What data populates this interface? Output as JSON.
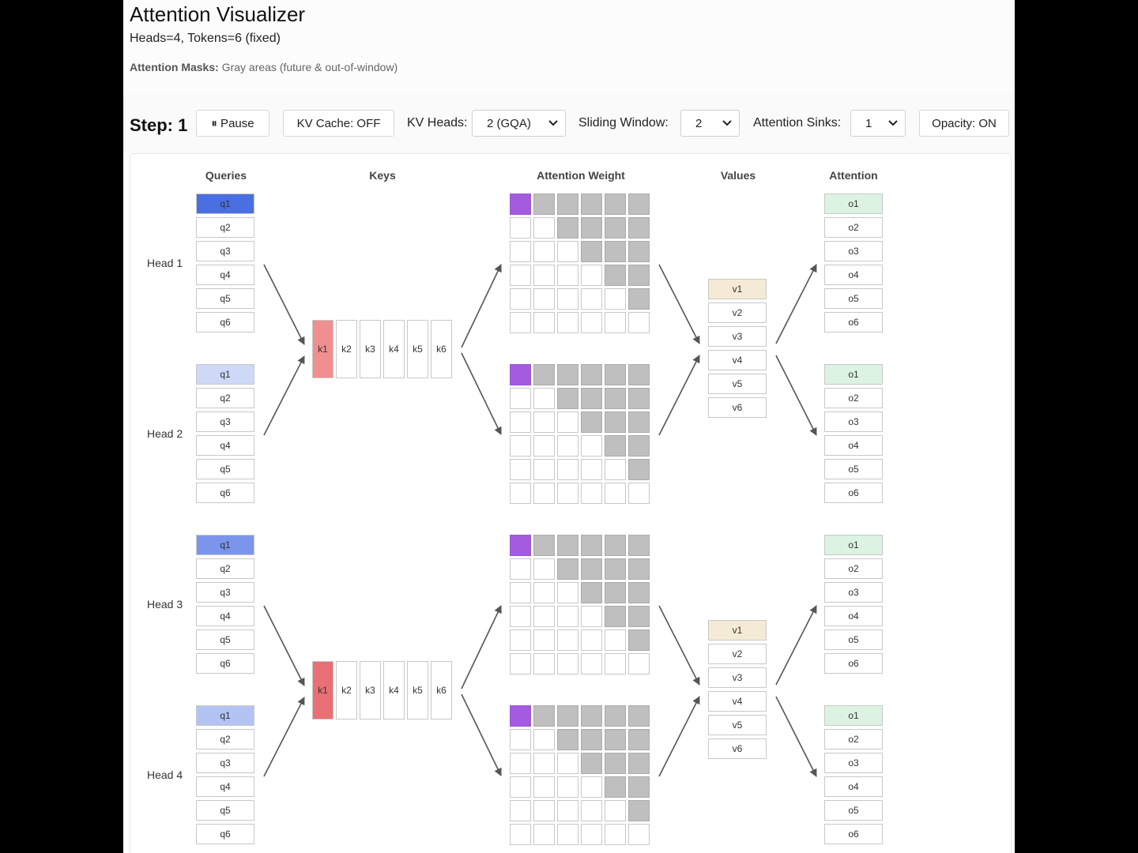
{
  "header": {
    "title": "Attention Visualizer",
    "subtitle": "Heads=4, Tokens=6 (fixed)",
    "mask_label": "Attention Masks:",
    "mask_desc": "Gray areas (future & out-of-window)"
  },
  "controls": {
    "step": "Step: 1",
    "pause_label": "⏸ Pause",
    "kv_cache_label": "KV Cache: OFF",
    "kv_heads_label": "KV Heads:",
    "kv_heads_value": "2 (GQA)",
    "sliding_window_label": "Sliding Window:",
    "sliding_window_value": "2",
    "attention_sinks_label": "Attention Sinks:",
    "attention_sinks_value": "1",
    "opacity_label": "Opacity: ON"
  },
  "columns": {
    "queries": "Queries",
    "keys": "Keys",
    "weights": "Attention Weight",
    "values": "Values",
    "attention": "Attention"
  },
  "heads": [
    {
      "label": "Head 1",
      "query_color": "#4a6fe0"
    },
    {
      "label": "Head 2",
      "query_color": "#cdd9f7"
    },
    {
      "label": "Head 3",
      "query_color": "#7b95ec"
    },
    {
      "label": "Head 4",
      "query_color": "#b3c4f4"
    }
  ],
  "queries": [
    "q1",
    "q2",
    "q3",
    "q4",
    "q5",
    "q6"
  ],
  "keys": [
    "k1",
    "k2",
    "k3",
    "k4",
    "k5",
    "k6"
  ],
  "values": [
    "v1",
    "v2",
    "v3",
    "v4",
    "v5",
    "v6"
  ],
  "outputs": [
    "o1",
    "o2",
    "o3",
    "o4",
    "o5",
    "o6"
  ],
  "colors": {
    "active_key_group1": "#f08f8f",
    "active_key_group2": "#ea6f74",
    "active_value": "#f5ead6",
    "active_output": "#dcf3e2",
    "active_weight": "#a55be0",
    "masked": "#bfbfbf"
  }
}
